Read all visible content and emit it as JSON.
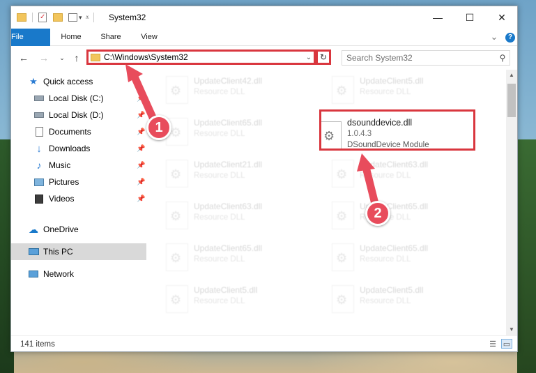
{
  "window": {
    "title": "System32",
    "minimize": "—",
    "maximize": "☐",
    "close": "✕"
  },
  "ribbon": {
    "tabs": [
      "File",
      "Home",
      "Share",
      "View"
    ],
    "expand": "⌄",
    "help": "?"
  },
  "address": {
    "path": "C:\\Windows\\System32",
    "dropdown": "⌄",
    "refresh": "↻"
  },
  "search": {
    "placeholder": "Search System32",
    "icon": "search-icon"
  },
  "nav": {
    "quick_access": "Quick access",
    "items": [
      {
        "label": "Local Disk (C:)",
        "icon": "drive-icon",
        "pinned": true
      },
      {
        "label": "Local Disk (D:)",
        "icon": "drive-icon",
        "pinned": true
      },
      {
        "label": "Documents",
        "icon": "documents-icon",
        "pinned": true
      },
      {
        "label": "Downloads",
        "icon": "downloads-icon",
        "pinned": true
      },
      {
        "label": "Music",
        "icon": "music-icon",
        "pinned": true
      },
      {
        "label": "Pictures",
        "icon": "pictures-icon",
        "pinned": true
      },
      {
        "label": "Videos",
        "icon": "videos-icon",
        "pinned": true
      }
    ],
    "onedrive": "OneDrive",
    "this_pc": "This PC",
    "network": "Network"
  },
  "files": {
    "col1": [
      {
        "name": "UpdateClient42.dll",
        "desc": "Resource DLL"
      },
      {
        "name": "UpdateClient65.dll",
        "desc": "Resource DLL"
      },
      {
        "name": "UpdateClient21.dll",
        "desc": "Resource DLL"
      },
      {
        "name": "UpdateClient63.dll",
        "desc": "Resource DLL"
      },
      {
        "name": "UpdateClient65.dll",
        "desc": "Resource DLL"
      },
      {
        "name": "UpdateClient5.dll",
        "desc": "Resource DLL"
      }
    ],
    "col2": [
      {
        "name": "UpdateClient5.dll",
        "desc": "Resource DLL"
      },
      {
        "name": "UpdateClient63.dll",
        "desc": "Resource DLL"
      },
      {
        "name": "UpdateClient65.dll",
        "desc": "Resource DLL"
      },
      {
        "name": "UpdateClient65.dll",
        "desc": "Resource DLL"
      },
      {
        "name": "UpdateClient5.dll",
        "desc": "Resource DLL"
      }
    ],
    "highlighted": {
      "name": "dsounddevice.dll",
      "version": "1.0.4.3",
      "description": "DSoundDevice Module"
    }
  },
  "status": {
    "item_count": "141 items"
  },
  "annotations": {
    "step1": "1",
    "step2": "2",
    "color": "#e84c5c"
  }
}
